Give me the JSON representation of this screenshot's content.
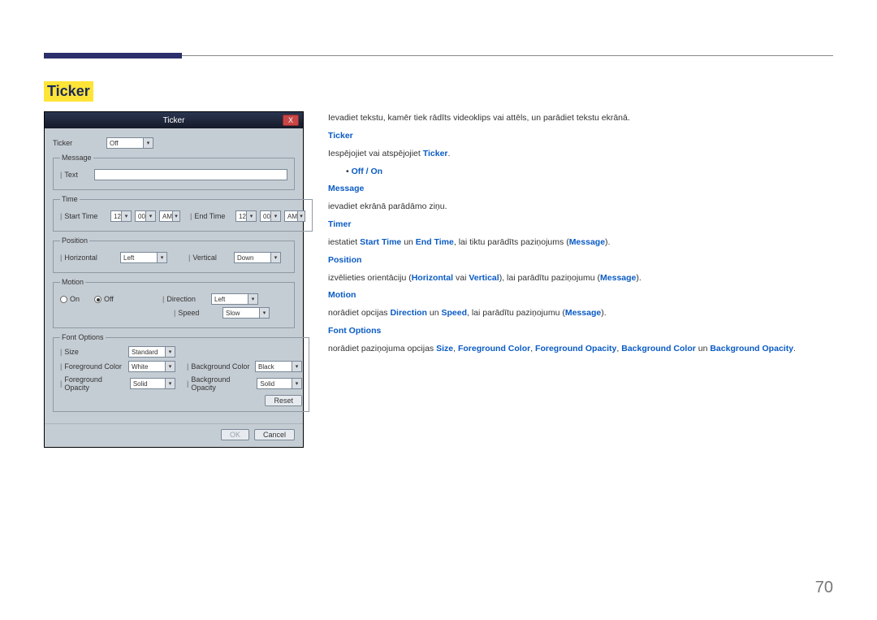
{
  "page_number": "70",
  "section_title": "Ticker",
  "intro": "Ievadiet tekstu, kamēr tiek rādīts videoklips vai attēls, un parādiet tekstu ekrānā.",
  "blocks": {
    "ticker": {
      "heading": "Ticker",
      "text_prefix": "Iespējojiet vai atspējojiet ",
      "text_bold": "Ticker",
      "text_suffix": ".",
      "bullet": "Off / On"
    },
    "message": {
      "heading": "Message",
      "text": "ievadiet ekrānā parādāmo ziņu."
    },
    "timer": {
      "heading": "Timer",
      "p1": "iestatiet ",
      "b1": "Start Time",
      "mid1": " un ",
      "b2": "End Time",
      "mid2": ", lai tiktu parādīts paziņojums (",
      "b3": "Message",
      "end": ")."
    },
    "position": {
      "heading": "Position",
      "p1": "izvēlieties orientāciju (",
      "b1": "Horizontal",
      "mid1": " vai ",
      "b2": "Vertical",
      "mid2": "), lai parādītu paziņojumu (",
      "b3": "Message",
      "end": ")."
    },
    "motion": {
      "heading": "Motion",
      "p1": "norādiet opcijas ",
      "b1": "Direction",
      "mid1": " un ",
      "b2": "Speed",
      "mid2": ", lai parādītu paziņojumu (",
      "b3": "Message",
      "end": ")."
    },
    "font": {
      "heading": "Font Options",
      "p1": "norādiet paziņojuma opcijas ",
      "b1": "Size",
      "c1": ", ",
      "b2": "Foreground Color",
      "c2": ", ",
      "b3": "Foreground Opacity",
      "c3": ", ",
      "b4": "Background Color",
      "mid": " un ",
      "b5": "Background Opacity",
      "end": "."
    }
  },
  "dialog": {
    "title": "Ticker",
    "close": "X",
    "ticker_label": "Ticker",
    "ticker_value": "Off",
    "group_message": "Message",
    "text_label": "Text",
    "group_time": "Time",
    "start_time": "Start Time",
    "end_time": "End Time",
    "hh": "12",
    "mm": "00",
    "ampm": "AM",
    "group_position": "Position",
    "horizontal": "Horizontal",
    "horizontal_value": "Left",
    "vertical": "Vertical",
    "vertical_value": "Down",
    "group_motion": "Motion",
    "on": "On",
    "off": "Off",
    "direction": "Direction",
    "direction_value": "Left",
    "speed": "Speed",
    "speed_value": "Slow",
    "group_font": "Font Options",
    "size": "Size",
    "size_value": "Standard",
    "fg_color": "Foreground Color",
    "fg_color_value": "White",
    "bg_color": "Background Color",
    "bg_color_value": "Black",
    "fg_opacity": "Foreground Opacity",
    "fg_opacity_value": "Solid",
    "bg_opacity": "Background Opacity",
    "bg_opacity_value": "Solid",
    "reset": "Reset",
    "ok": "OK",
    "cancel": "Cancel"
  }
}
